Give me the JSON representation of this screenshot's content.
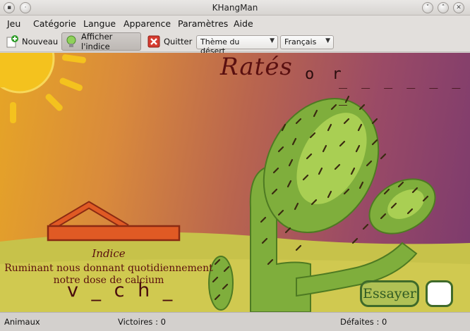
{
  "window": {
    "title": "KHangMan"
  },
  "menu": {
    "items": [
      "Jeu",
      "Catégorie",
      "Langue",
      "Apparence",
      "Paramètres",
      "Aide"
    ]
  },
  "toolbar": {
    "new_label": "Nouveau",
    "hint_label": "Afficher l'indice",
    "quit_label": "Quitter",
    "theme_value": "Thème du désert",
    "language_value": "Français"
  },
  "game": {
    "missed_label": "Ratés",
    "missed_letters": "o r",
    "missed_slots": "_ _ _ _ _ _ _",
    "hint_title": "Indice",
    "hint_text_line1": "Ruminant nous donnant quotidiennement",
    "hint_text_line2": "notre dose de calcium",
    "word": "v _ c h _",
    "try_button": "Essayer",
    "letter_value": ""
  },
  "status": {
    "category": "Animaux",
    "wins": "Victoires : 0",
    "losses": "Défaites : 0"
  },
  "colors": {
    "text_dark_red": "#5a0e0e",
    "cactus_green": "#7fae3c",
    "sun_yellow": "#f4c21e",
    "ground_green": "#c7c24a"
  }
}
